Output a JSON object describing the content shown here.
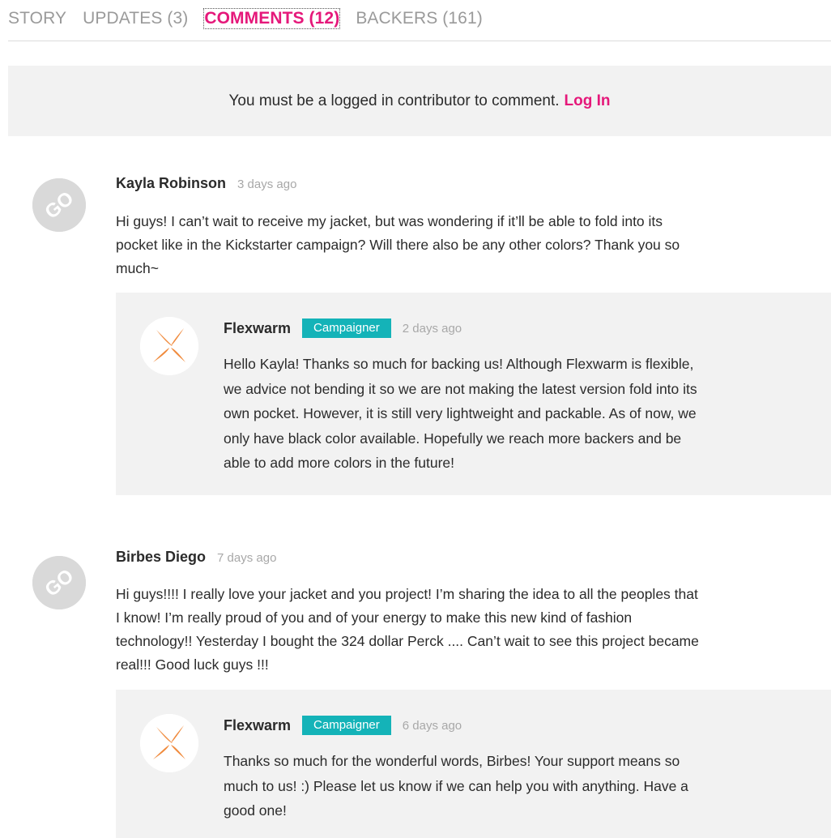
{
  "tabs": [
    {
      "label": "STORY"
    },
    {
      "label": "UPDATES (3)"
    },
    {
      "label": "COMMENTS (12)"
    },
    {
      "label": "BACKERS (161)"
    }
  ],
  "active_tab": "COMMENTS (12)",
  "login_banner": {
    "text": "You must be a logged in contributor to comment.",
    "link": "Log In"
  },
  "comments": [
    {
      "author": "Kayla Robinson",
      "time": "3 days ago",
      "avatar_icon": "go-avatar-icon",
      "body_lines": [
        "Hi guys! I can’t wait to receive my jacket, but was wondering if it’ll be able to fold into its",
        "pocket like in the Kickstarter campaign? Will there also be any other colors? Thank you so",
        "much~"
      ],
      "reply": {
        "author": "Flexwarm",
        "badge": "Campaigner",
        "time": "2 days ago",
        "avatar_icon": "flexwarm-logo-icon",
        "body_lines": [
          "Hello Kayla! Thanks so much for backing us! Although Flexwarm is flexible,",
          "we advice not bending it so we are not making the latest version fold into its",
          "own pocket. However, it is still very lightweight and packable. As of now, we",
          "only have black color available. Hopefully we reach more backers and be",
          "able to add more colors in the future!"
        ]
      }
    },
    {
      "author": "Birbes Diego",
      "time": "7 days ago",
      "avatar_icon": "go-avatar-icon",
      "body_lines": [
        "Hi guys!!!! I really love your jacket and you project! I’m sharing the idea to all the peoples that",
        "I know! I’m really proud of you and of your energy to make this new kind of fashion",
        "technology!! Yesterday I bought the 324 dollar Perck .... Can’t wait to see this project became",
        "real!!! Good luck guys !!!"
      ],
      "reply": {
        "author": "Flexwarm",
        "badge": "Campaigner",
        "time": "6 days ago",
        "avatar_icon": "flexwarm-logo-icon",
        "body_lines": [
          "Thanks so much for the wonderful words, Birbes! Your support means so",
          "much to us! :) Please let us know if we can help you with anything. Have a",
          "good one!"
        ]
      }
    }
  ],
  "colors": {
    "accent": "#e5187a",
    "badge": "#14b3b8",
    "panel": "#f2f2f2",
    "muted": "#a8a8a8"
  }
}
